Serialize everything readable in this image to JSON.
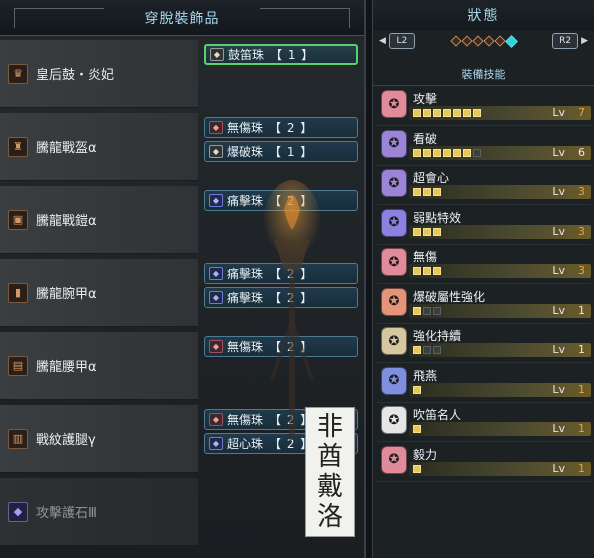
{
  "left": {
    "title": "穿脫裝飾品",
    "rows": [
      {
        "name": "皇后鼓・炎妃",
        "icon": "head-armor-icon",
        "dim": false,
        "decos": [
          {
            "name": "鼓笛珠",
            "level": "【 1 】",
            "gem": "gray",
            "selected": true
          }
        ]
      },
      {
        "name": "騰龍戰盔α",
        "icon": "helm-armor-icon",
        "dim": false,
        "decos": [
          {
            "name": "無傷珠",
            "level": "【 2 】",
            "gem": "red",
            "selected": false
          },
          {
            "name": "爆破珠",
            "level": "【 1 】",
            "gem": "gray",
            "selected": false
          }
        ]
      },
      {
        "name": "騰龍戰鎧α",
        "icon": "chest-armor-icon",
        "dim": false,
        "decos": [
          {
            "name": "痛擊珠",
            "level": "【 2 】",
            "gem": "blue",
            "selected": false
          }
        ]
      },
      {
        "name": "騰龍腕甲α",
        "icon": "arm-armor-icon",
        "dim": false,
        "decos": [
          {
            "name": "痛擊珠",
            "level": "【 2 】",
            "gem": "blue",
            "selected": false
          },
          {
            "name": "痛擊珠",
            "level": "【 2 】",
            "gem": "blue",
            "selected": false
          }
        ]
      },
      {
        "name": "騰龍腰甲α",
        "icon": "waist-armor-icon",
        "dim": false,
        "decos": [
          {
            "name": "無傷珠",
            "level": "【 2 】",
            "gem": "red",
            "selected": false
          }
        ]
      },
      {
        "name": "戰紋護腿γ",
        "icon": "leg-armor-icon",
        "dim": false,
        "decos": [
          {
            "name": "無傷珠",
            "level": "【 2 】",
            "gem": "red",
            "selected": false
          },
          {
            "name": "超心珠",
            "level": "【 2 】",
            "gem": "blue",
            "selected": false
          }
        ]
      },
      {
        "name": "攻擊護石Ⅲ",
        "icon": "charm-icon",
        "dim": true,
        "decos": []
      }
    ],
    "watermark": [
      "非",
      "酋",
      "戴",
      "洛"
    ]
  },
  "right": {
    "title": "狀態",
    "l2": "L2",
    "r2": "R2",
    "page_count": 6,
    "active_page": 5,
    "skills_title": "裝備技能",
    "lv_text": "Lv",
    "skills": [
      {
        "name": "攻擊",
        "level": "7",
        "max": 7,
        "max_reached": true,
        "color": "#e08a9a"
      },
      {
        "name": "看破",
        "level": "6",
        "max": 7,
        "max_reached": false,
        "color": "#9a84d8"
      },
      {
        "name": "超會心",
        "level": "3",
        "max": 3,
        "max_reached": true,
        "color": "#9a84d8"
      },
      {
        "name": "弱點特效",
        "level": "3",
        "max": 3,
        "max_reached": true,
        "color": "#8c80e0"
      },
      {
        "name": "無傷",
        "level": "3",
        "max": 3,
        "max_reached": true,
        "color": "#e08a9a"
      },
      {
        "name": "爆破屬性強化",
        "level": "1",
        "max": 3,
        "max_reached": false,
        "color": "#e5947a"
      },
      {
        "name": "強化持續",
        "level": "1",
        "max": 3,
        "max_reached": false,
        "color": "#d7c7a0"
      },
      {
        "name": "飛燕",
        "level": "1",
        "max": 1,
        "max_reached": true,
        "color": "#7e8fe0"
      },
      {
        "name": "吹笛名人",
        "level": "1",
        "max": 1,
        "max_reached": true,
        "color": "#e6e6e6"
      },
      {
        "name": "毅力",
        "level": "1",
        "max": 1,
        "max_reached": true,
        "color": "#e08a9a"
      }
    ]
  }
}
